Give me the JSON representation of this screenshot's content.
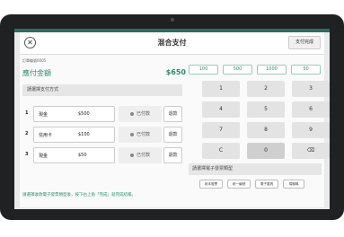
{
  "header": {
    "title": "混合支付",
    "done_label": "支付完成",
    "close_icon": "✕"
  },
  "order": {
    "number_label": "訂單編號0005"
  },
  "amount": {
    "label": "應付金額",
    "value": "$650"
  },
  "methods_section": {
    "label": "請選擇支付方式"
  },
  "payments": [
    {
      "index": "1",
      "method": "現金",
      "amount": "$500",
      "status": "已付款",
      "refund": "退款"
    },
    {
      "index": "2",
      "method": "信用卡",
      "amount": "$100",
      "status": "已付款",
      "refund": "退款"
    },
    {
      "index": "3",
      "method": "現金",
      "amount": "$50",
      "status": "已付款",
      "refund": "退款"
    }
  ],
  "quick_amounts": [
    "100",
    "500",
    "1000",
    "50"
  ],
  "keypad": [
    "1",
    "2",
    "3",
    "4",
    "5",
    "6",
    "7",
    "8",
    "9",
    "C",
    "0",
    "⌫"
  ],
  "einvoice": {
    "label": "請選擇電子發票類型",
    "options": [
      "紙本發票",
      "統一編號",
      "電子載具",
      "捐贈碼"
    ]
  },
  "footer": {
    "note": "請選擇收款電子發票類型後，按下右上角「完成」就完成結帳。"
  },
  "colors": {
    "accent": "#2e8b6e",
    "bezel": "#1f2123"
  }
}
